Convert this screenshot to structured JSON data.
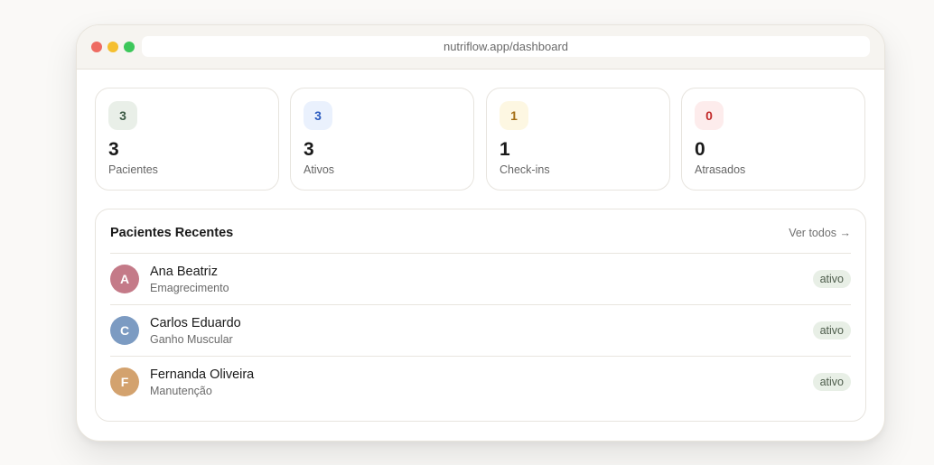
{
  "browser": {
    "url": "nutriflow.app/dashboard",
    "traffic_lights": {
      "close": "#ee6b62",
      "minimize": "#f5bf30",
      "maximize": "#3cc75a"
    }
  },
  "stats": [
    {
      "badge": "3",
      "value": "3",
      "label": "Pacientes",
      "badge_bg": "#e9efe8",
      "badge_color": "#3c5a44"
    },
    {
      "badge": "3",
      "value": "3",
      "label": "Ativos",
      "badge_bg": "#eaf1fd",
      "badge_color": "#2b5bbf"
    },
    {
      "badge": "1",
      "value": "1",
      "label": "Check-ins",
      "badge_bg": "#fdf7e2",
      "badge_color": "#a36d13"
    },
    {
      "badge": "0",
      "value": "0",
      "label": "Atrasados",
      "badge_bg": "#fdecec",
      "badge_color": "#c22a2a"
    }
  ],
  "recent": {
    "title": "Pacientes Recentes",
    "link": "Ver todos →",
    "patients": [
      {
        "initial": "A",
        "name": "Ana Beatriz",
        "goal": "Emagrecimento",
        "status": "ativo",
        "avatar_color": "#c47a88"
      },
      {
        "initial": "C",
        "name": "Carlos Eduardo",
        "goal": "Ganho Muscular",
        "status": "ativo",
        "avatar_color": "#7c9bc2"
      },
      {
        "initial": "F",
        "name": "Fernanda Oliveira",
        "goal": "Manutenção",
        "status": "ativo",
        "avatar_color": "#d3a26e"
      }
    ]
  }
}
